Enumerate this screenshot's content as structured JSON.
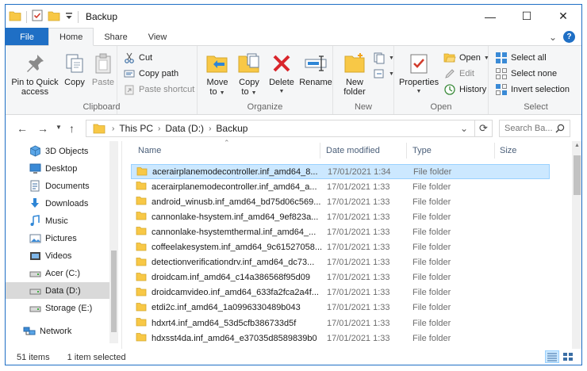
{
  "window": {
    "title": "Backup",
    "controls": {
      "minimize": "—",
      "maximize": "☐",
      "close": "✕"
    }
  },
  "ribbon_tabs": {
    "file": "File",
    "home": "Home",
    "share": "Share",
    "view": "View",
    "expand_caret": "⌄",
    "help": "?"
  },
  "clipboard": {
    "pin_line1": "Pin to Quick",
    "pin_line2": "access",
    "copy": "Copy",
    "paste": "Paste",
    "cut": "Cut",
    "copy_path": "Copy path",
    "paste_shortcut": "Paste shortcut",
    "label": "Clipboard"
  },
  "organize": {
    "move_to_line1": "Move",
    "move_to_line2": "to",
    "copy_to_line1": "Copy",
    "copy_to_line2": "to",
    "delete": "Delete",
    "rename": "Rename",
    "label": "Organize"
  },
  "new_group": {
    "new_folder_line1": "New",
    "new_folder_line2": "folder",
    "label": "New"
  },
  "open_group": {
    "properties": "Properties",
    "open": "Open",
    "edit": "Edit",
    "history": "History",
    "label": "Open"
  },
  "select_group": {
    "select_all": "Select all",
    "select_none": "Select none",
    "invert_selection": "Invert selection",
    "label": "Select"
  },
  "address": {
    "crumb1": "This PC",
    "crumb2": "Data (D:)",
    "crumb3": "Backup",
    "search_placeholder": "Search Ba..."
  },
  "nav_items": [
    {
      "label": "3D Objects",
      "icon": "3d-objects-icon"
    },
    {
      "label": "Desktop",
      "icon": "desktop-icon"
    },
    {
      "label": "Documents",
      "icon": "documents-icon"
    },
    {
      "label": "Downloads",
      "icon": "downloads-icon"
    },
    {
      "label": "Music",
      "icon": "music-icon"
    },
    {
      "label": "Pictures",
      "icon": "pictures-icon"
    },
    {
      "label": "Videos",
      "icon": "videos-icon"
    },
    {
      "label": "Acer (C:)",
      "icon": "drive-icon"
    },
    {
      "label": "Data (D:)",
      "icon": "drive-icon",
      "selected": true
    },
    {
      "label": "Storage (E:)",
      "icon": "drive-icon"
    },
    {
      "label": "Network",
      "icon": "network-icon"
    }
  ],
  "columns": {
    "name": "Name",
    "date_modified": "Date modified",
    "type": "Type",
    "size": "Size"
  },
  "files": [
    {
      "name": "acerairplanemodecontroller.inf_amd64_8...",
      "date": "17/01/2021 1:34",
      "type": "File folder",
      "selected": true
    },
    {
      "name": "acerairplanemodecontroller.inf_amd64_a...",
      "date": "17/01/2021 1:33",
      "type": "File folder"
    },
    {
      "name": "android_winusb.inf_amd64_bd75d06c569...",
      "date": "17/01/2021 1:33",
      "type": "File folder"
    },
    {
      "name": "cannonlake-hsystem.inf_amd64_9ef823a...",
      "date": "17/01/2021 1:33",
      "type": "File folder"
    },
    {
      "name": "cannonlake-hsystemthermal.inf_amd64_...",
      "date": "17/01/2021 1:33",
      "type": "File folder"
    },
    {
      "name": "coffeelakesystem.inf_amd64_9c61527058...",
      "date": "17/01/2021 1:33",
      "type": "File folder"
    },
    {
      "name": "detectionverificationdrv.inf_amd64_dc73...",
      "date": "17/01/2021 1:33",
      "type": "File folder"
    },
    {
      "name": "droidcam.inf_amd64_c14a386568f95d09",
      "date": "17/01/2021 1:33",
      "type": "File folder"
    },
    {
      "name": "droidcamvideo.inf_amd64_633fa2fca2a4f...",
      "date": "17/01/2021 1:33",
      "type": "File folder"
    },
    {
      "name": "etdi2c.inf_amd64_1a0996330489b043",
      "date": "17/01/2021 1:33",
      "type": "File folder"
    },
    {
      "name": "hdxrt4.inf_amd64_53d5cfb386733d5f",
      "date": "17/01/2021 1:33",
      "type": "File folder"
    },
    {
      "name": "hdxsst4da.inf_amd64_e37035d8589839b0",
      "date": "17/01/2021 1:33",
      "type": "File folder"
    }
  ],
  "status": {
    "items": "51 items",
    "selected": "1 item selected"
  },
  "colors": {
    "accent": "#1f6fc5",
    "selection_bg": "#cce8ff",
    "selection_border": "#99d1ff",
    "folder": "#f8c846"
  }
}
